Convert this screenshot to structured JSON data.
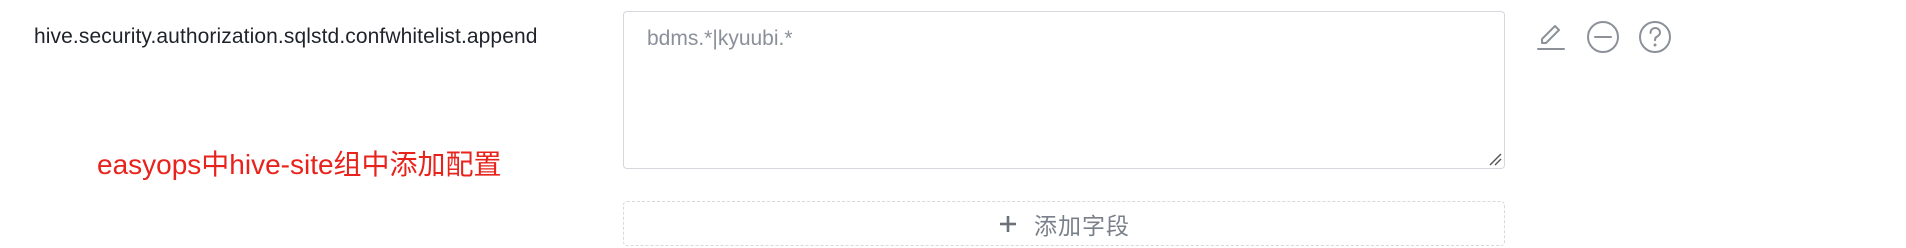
{
  "field": {
    "label": "hive.security.authorization.sqlstd.confwhitelist.append",
    "value": "bdms.*|kyuubi.*"
  },
  "actions": [
    {
      "icon": "edit-icon"
    },
    {
      "icon": "remove-circle-icon"
    },
    {
      "icon": "help-circle-icon"
    }
  ],
  "annotation": "easyops中hive-site组中添加配置",
  "add_field": {
    "icon": "plus-icon",
    "label": "添加字段"
  },
  "colors": {
    "label": "#1f2329",
    "value": "#8a8f99",
    "annotation": "#e8231c",
    "border": "#d4d7dc",
    "icon": "#8c9199"
  }
}
